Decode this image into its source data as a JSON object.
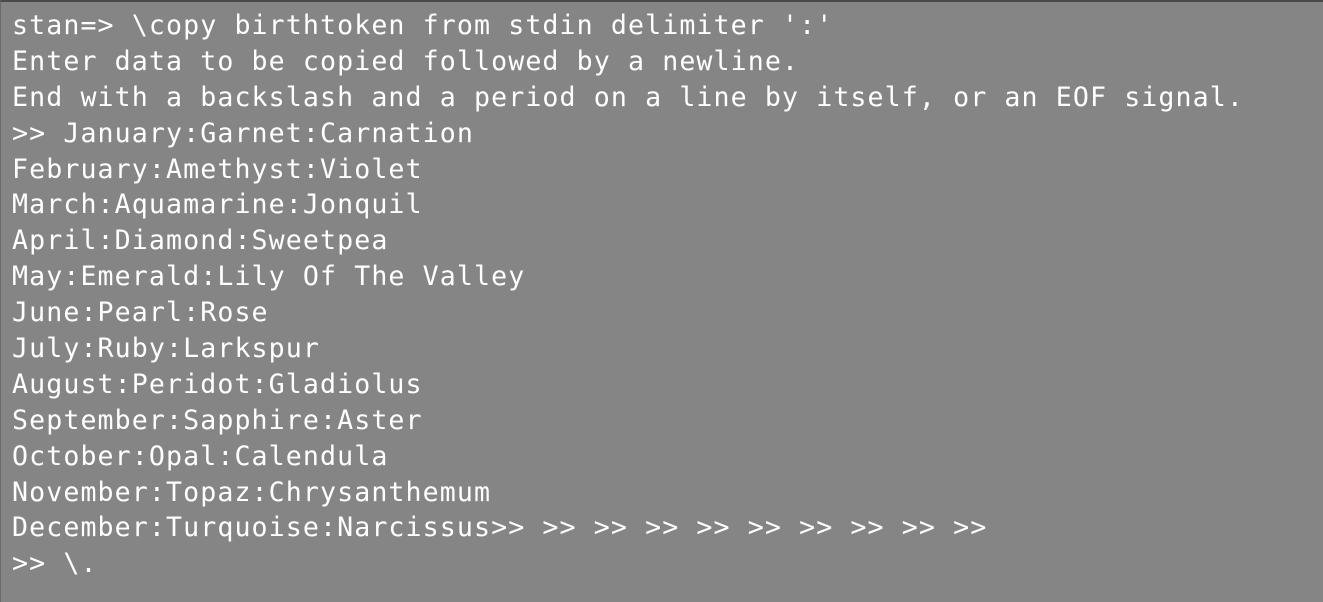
{
  "terminal": {
    "lines": [
      "stan=> \\copy birthtoken from stdin delimiter ':'",
      "Enter data to be copied followed by a newline.",
      "End with a backslash and a period on a line by itself, or an EOF signal.",
      ">> January:Garnet:Carnation",
      "February:Amethyst:Violet",
      "March:Aquamarine:Jonquil",
      "April:Diamond:Sweetpea",
      "May:Emerald:Lily Of The Valley",
      "June:Pearl:Rose",
      "July:Ruby:Larkspur",
      "August:Peridot:Gladiolus",
      "September:Sapphire:Aster",
      "October:Opal:Calendula",
      "November:Topaz:Chrysanthemum",
      "December:Turquoise:Narcissus>> >> >> >> >> >> >> >> >> >>",
      ">> \\."
    ]
  }
}
